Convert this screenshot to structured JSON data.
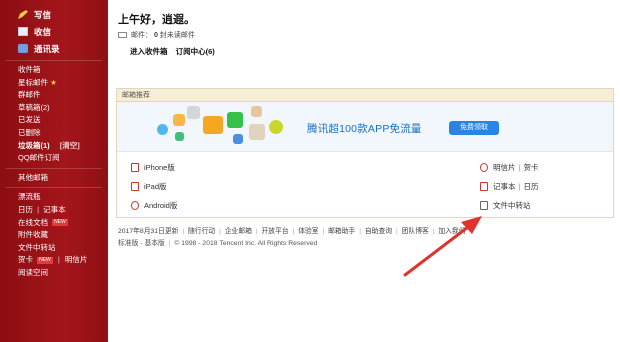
{
  "sidebar": {
    "top": {
      "write": "写信",
      "inbox": "收信",
      "contacts": "通讯录"
    },
    "folders": {
      "inbox": "收件箱",
      "starred": "星标邮件",
      "starred_star": "★",
      "groups": "群邮件",
      "drafts": "草稿箱(2)",
      "sent": "已发送",
      "deleted": "已删除",
      "spam": "垃圾箱(1)",
      "spam_clear": "[清空]",
      "qq_subs": "QQ邮件订阅"
    },
    "other_mailbox": "其他邮箱",
    "tools": {
      "bottle": "漂流瓶",
      "calendar": "日历",
      "notes": "记事本",
      "docs": "在线文档",
      "docs_tag": "NEW",
      "attachments": "附件收藏",
      "transfer": "文件中转站",
      "cards": "贺卡",
      "cards_tag": "NEW",
      "postcard": "明信片",
      "reading": "阅读空间",
      "sep": "|"
    }
  },
  "main": {
    "greeting": "上午好，逍遐。",
    "mail_prefix": "邮件：",
    "unread_count": "0",
    "mail_suffix": "封未读邮件",
    "links": {
      "inbox": "进入收件箱",
      "subs": "订阅中心(6)"
    },
    "recommend": {
      "header": "邮箱推荐",
      "banner_text": "腾讯超100款APP免流量",
      "banner_button": "免费领取"
    },
    "devices": {
      "iphone": "iPhone版",
      "ipad": "iPad版",
      "android": "Android版",
      "postcard": "明信片",
      "card": "贺卡",
      "notes": "记事本",
      "calendar": "日历",
      "transfer": "文件中转站",
      "pipe": "|"
    },
    "footer": {
      "updated": "2017年8月31日更新",
      "l1": "随行行动",
      "l2": "企业邮箱",
      "l3": "开放平台",
      "l4": "体验室",
      "l5": "邮箱助手",
      "l6": "自助查询",
      "l7": "团队博客",
      "l8": "加入我们",
      "sep": "|",
      "standard": "标准版",
      "basic": "基本版",
      "copyright": "© 1998 - 2018 Tencent Inc. All Rights Reserved",
      "dash": "-"
    }
  },
  "colors": {
    "sidebar_bg": "#a3161b",
    "banner_text": "#1a6fc4",
    "banner_button": "#2a84e3",
    "arrow": "#e0322e"
  }
}
